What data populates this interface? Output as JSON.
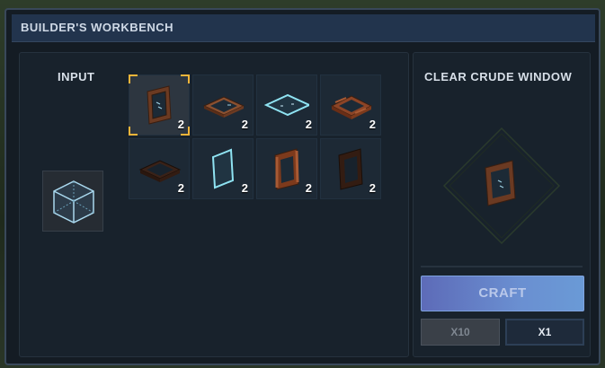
{
  "window": {
    "title": "BUILDER'S WORKBENCH"
  },
  "input": {
    "label": "INPUT",
    "item_icon": "glass-cube-icon"
  },
  "recipes": [
    {
      "icon": "window-frame-upright-icon",
      "qty": "2",
      "selected": true
    },
    {
      "icon": "window-frame-flat-icon",
      "qty": "2",
      "selected": false
    },
    {
      "icon": "glass-pane-flat-icon",
      "qty": "2",
      "selected": false
    },
    {
      "icon": "log-frame-flat-icon",
      "qty": "2",
      "selected": false
    },
    {
      "icon": "dark-frame-flat-icon",
      "qty": "2",
      "selected": false
    },
    {
      "icon": "glass-pane-upright-icon",
      "qty": "2",
      "selected": false
    },
    {
      "icon": "log-frame-upright-icon",
      "qty": "2",
      "selected": false
    },
    {
      "icon": "dark-frame-upright-icon",
      "qty": "2",
      "selected": false
    }
  ],
  "output": {
    "title": "CLEAR CRUDE WINDOW",
    "preview_icon": "window-frame-upright-icon"
  },
  "actions": {
    "craft_label": "CRAFT",
    "x10_label": "X10",
    "x1_label": "X1"
  },
  "colors": {
    "selection": "#f2b53a",
    "craft_button": "#6a8fd1",
    "wood": "#7a4528",
    "glass": "#7fd6e8"
  }
}
